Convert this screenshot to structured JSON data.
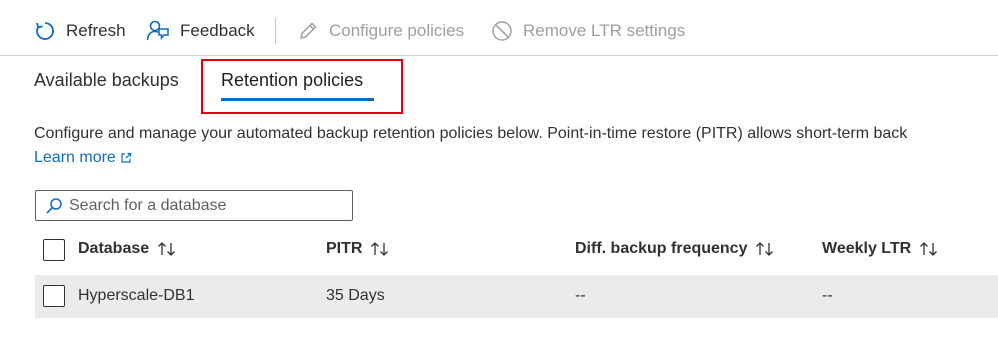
{
  "toolbar": {
    "refresh_label": "Refresh",
    "feedback_label": "Feedback",
    "configure_label": "Configure policies",
    "remove_label": "Remove LTR settings"
  },
  "tabs": [
    {
      "label": "Available backups",
      "selected": false
    },
    {
      "label": "Retention policies",
      "selected": true
    }
  ],
  "description": "Configure and manage your automated backup retention policies below. Point-in-time restore (PITR) allows short-term back",
  "learn_more": "Learn more",
  "search": {
    "placeholder": "Search for a database",
    "value": ""
  },
  "grid": {
    "columns": [
      "Database",
      "PITR",
      "Diff. backup frequency",
      "Weekly LTR"
    ],
    "rows": [
      {
        "database": "Hyperscale-DB1",
        "pitr": "35 Days",
        "diff": "--",
        "weekly": "--"
      }
    ]
  },
  "colors": {
    "accent": "#0f6cbd",
    "highlight": "#e3000f",
    "row_background": "#edebe9",
    "disabled_text": "#a19f9d"
  },
  "icons": {
    "refresh": "refresh-icon",
    "feedback": "feedback-icon",
    "configure": "edit-icon",
    "remove": "block-icon",
    "learn_more": "external-link-icon",
    "search": "search-icon",
    "sort": "sort-icon"
  }
}
